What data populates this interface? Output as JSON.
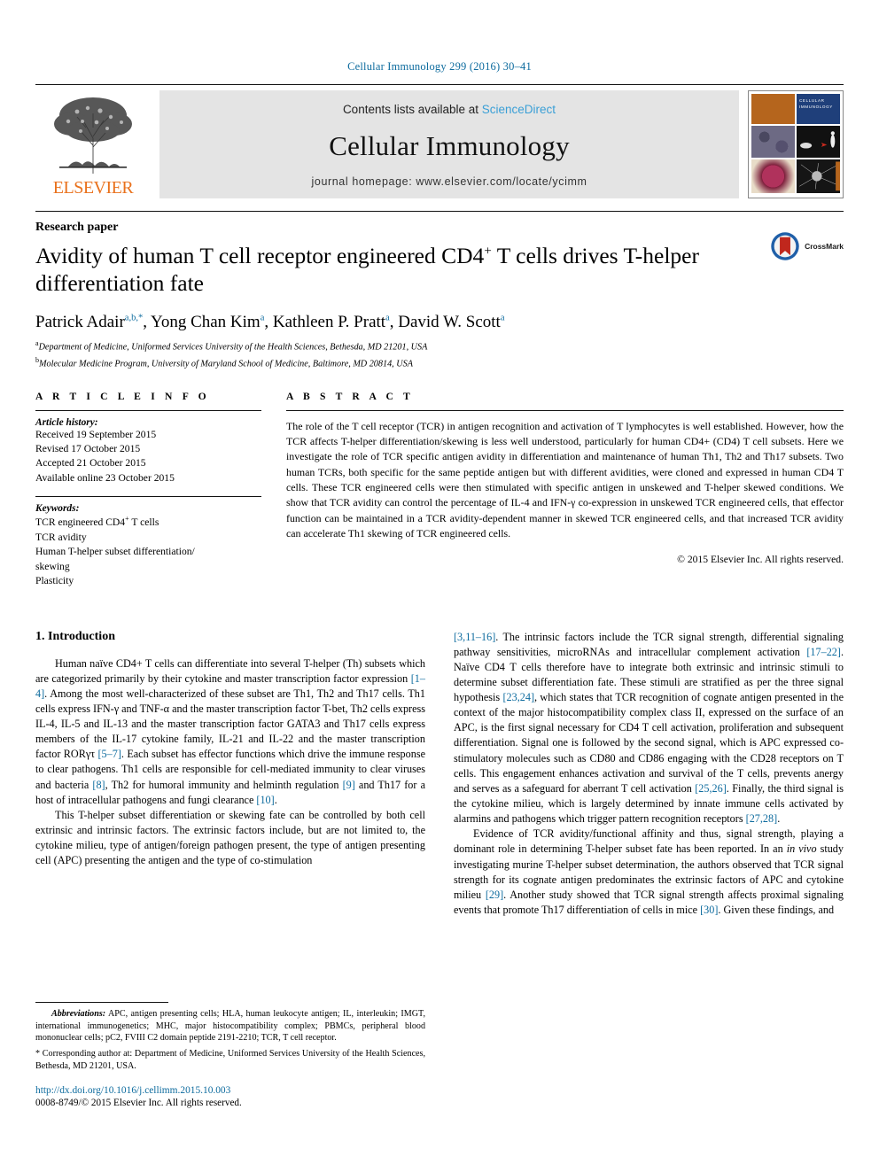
{
  "running_head": "Cellular Immunology 299 (2016) 30–41",
  "masthead": {
    "publisher": "ELSEVIER",
    "contents_prefix": "Contents lists available at ",
    "sciencedirect": "ScienceDirect",
    "journal_title": "Cellular Immunology",
    "homepage": "journal homepage: www.elsevier.com/locate/ycimm",
    "cover_caption": "CELLULAR IMMUNOLOGY"
  },
  "article": {
    "kicker": "Research paper",
    "title_line1": "Avidity of human T cell receptor engineered CD4",
    "title_sup": "+",
    "title_line1b": " T cells drives T-helper",
    "title_line2": "differentiation fate",
    "crossmark_label": "CrossMark",
    "authors": [
      {
        "name": "Patrick Adair",
        "sup": "a,b,*"
      },
      {
        "name": "Yong Chan Kim",
        "sup": "a"
      },
      {
        "name": "Kathleen P. Pratt",
        "sup": "a"
      },
      {
        "name": "David W. Scott",
        "sup": "a"
      }
    ],
    "affiliations": [
      {
        "mark": "a",
        "text": "Department of Medicine, Uniformed Services University of the Health Sciences, Bethesda, MD 21201, USA"
      },
      {
        "mark": "b",
        "text": "Molecular Medicine Program, University of Maryland School of Medicine, Baltimore, MD 20814, USA"
      }
    ]
  },
  "info": {
    "heading": "A R T I C L E    I N F O",
    "history_label": "Article history:",
    "history": [
      "Received 19 September 2015",
      "Revised 17 October 2015",
      "Accepted 21 October 2015",
      "Available online 23 October 2015"
    ],
    "keywords_label": "Keywords:",
    "keywords": [
      "TCR engineered CD4+ T cells",
      "TCR avidity",
      "Human T-helper subset differentiation/",
      "skewing",
      "Plasticity"
    ]
  },
  "abstract": {
    "heading": "A B S T R A C T",
    "text": "The role of the T cell receptor (TCR) in antigen recognition and activation of T lymphocytes is well established. However, how the TCR affects T-helper differentiation/skewing is less well understood, particularly for human CD4+ (CD4) T cell subsets. Here we investigate the role of TCR specific antigen avidity in differentiation and maintenance of human Th1, Th2 and Th17 subsets. Two human TCRs, both specific for the same peptide antigen but with different avidities, were cloned and expressed in human CD4 T cells. These TCR engineered cells were then stimulated with specific antigen in unskewed and T-helper skewed conditions. We show that TCR avidity can control the percentage of IL-4 and IFN-γ co-expression in unskewed TCR engineered cells, that effector function can be maintained in a TCR avidity-dependent manner in skewed TCR engineered cells, and that increased TCR avidity can accelerate Th1 skewing of TCR engineered cells.",
    "copyright": "© 2015 Elsevier Inc. All rights reserved."
  },
  "intro": {
    "heading": "1. Introduction",
    "p1_a": "Human naïve CD4+ T cells can differentiate into several T-helper (Th) subsets which are categorized primarily by their cytokine and master transcription factor expression ",
    "p1_ref1": "[1–4]",
    "p1_b": ". Among the most well-characterized of these subset are Th1, Th2 and Th17 cells. Th1 cells express IFN-γ and TNF-α and the master transcription factor T-bet, Th2 cells express IL-4, IL-5 and IL-13 and the master transcription factor GATA3 and Th17 cells express members of the IL-17 cytokine family, IL-21 and IL-22 and the master transcription factor RORγτ ",
    "p1_ref2": "[5–7]",
    "p1_c": ". Each subset has effector functions which drive the immune response to clear pathogens. Th1 cells are responsible for cell-mediated immunity to clear viruses and bacteria ",
    "p1_ref3": "[8]",
    "p1_d": ", Th2 for humoral immunity and helminth regulation ",
    "p1_ref4": "[9]",
    "p1_e": " and Th17 for a host of intracellular pathogens and fungi clearance ",
    "p1_ref5": "[10]",
    "p1_f": ".",
    "p2": "This T-helper subset differentiation or skewing fate can be controlled by both cell extrinsic and intrinsic factors. The extrinsic factors include, but are not limited to, the cytokine milieu, type of antigen/foreign pathogen present, the type of antigen presenting cell (APC) presenting the antigen and the type of co-stimulation",
    "r_ref0": "[3,11–16]",
    "r_p1_a": ". The intrinsic factors include the TCR signal strength, differential signaling pathway sensitivities, microRNAs and intracellular complement activation ",
    "r_ref1": "[17–22]",
    "r_p1_b": ". Naïve CD4 T cells therefore have to integrate both extrinsic and intrinsic stimuli to determine subset differentiation fate. These stimuli are stratified as per the three signal hypothesis ",
    "r_ref2": "[23,24]",
    "r_p1_c": ", which states that TCR recognition of cognate antigen presented in the context of the major histocompatibility complex class II, expressed on the surface of an APC, is the first signal necessary for CD4 T cell activation, proliferation and subsequent differentiation. Signal one is followed by the second signal, which is APC expressed co-stimulatory molecules such as CD80 and CD86 engaging with the CD28 receptors on T cells. This engagement enhances activation and survival of the T cells, prevents anergy and serves as a safeguard for aberrant T cell activation ",
    "r_ref3": "[25,26]",
    "r_p1_d": ". Finally, the third signal is the cytokine milieu, which is largely determined by innate immune cells activated by alarmins and pathogens which trigger pattern recognition receptors ",
    "r_ref4": "[27,28]",
    "r_p1_e": ".",
    "r_p2_a": "Evidence of TCR avidity/functional affinity and thus, signal strength, playing a dominant role in determining T-helper subset fate has been reported. In an ",
    "r_p2_ital": "in vivo",
    "r_p2_b": " study investigating murine T-helper subset determination, the authors observed that TCR signal strength for its cognate antigen predominates the extrinsic factors of APC and cytokine milieu ",
    "r_ref5": "[29]",
    "r_p2_c": ". Another study showed that TCR signal strength affects proximal signaling events that promote Th17 differentiation of cells in mice ",
    "r_ref6": "[30]",
    "r_p2_d": ". Given these findings, and"
  },
  "footnotes": {
    "abbrev_label": "Abbreviations:",
    "abbrev_text": " APC, antigen presenting cells; HLA, human leukocyte antigen; IL, interleukin; IMGT, international immunogenetics; MHC, major histocompatibility complex; PBMCs, peripheral blood mononuclear cells; pC2, FVIII C2 domain peptide 2191-2210; TCR, T cell receptor.",
    "corresponding": "* Corresponding author at: Department of Medicine, Uniformed Services University of the Health Sciences, Bethesda, MD 21201, USA.",
    "doi": "http://dx.doi.org/10.1016/j.cellimm.2015.10.003",
    "issn": "0008-8749/© 2015 Elsevier Inc. All rights reserved."
  },
  "colors": {
    "link_blue": "#0d6b9e",
    "sciencedirect_blue": "#3a9fd6",
    "elsevier_orange": "#e9711c"
  }
}
